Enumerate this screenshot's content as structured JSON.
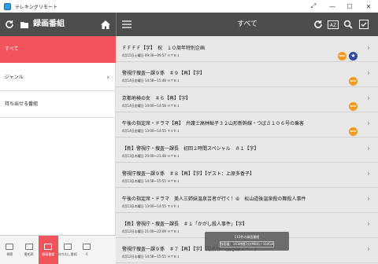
{
  "window": {
    "title": "テレキングリモート"
  },
  "left_header": {
    "title": "録画番組"
  },
  "right_header": {
    "title": "すべて"
  },
  "sidebar": {
    "items": [
      {
        "label": "すべて",
        "active": true
      },
      {
        "label": "ジャンル",
        "chevron": "›"
      },
      {
        "label": "持ち出せる番組"
      }
    ]
  },
  "bottom_nav": [
    {
      "label": "視聴"
    },
    {
      "label": "番組表"
    },
    {
      "label": "録画番組",
      "active": true
    },
    {
      "label": "持ち出し番組"
    },
    {
      "label": "そ"
    }
  ],
  "programs": [
    {
      "title": "ＦＦＦＦ【字】　祝　１０周年特別企画",
      "date": "4月15日土曜日 09:30～09:57 ＨＴＢ１",
      "new": true,
      "star": true
    },
    {
      "title": "警視庁捜査一課９係　＃９【再】【字】",
      "date": "4月14日金曜日 14:58～15:48 ＨＴＢ１",
      "new": true
    },
    {
      "title": "京都地検の女　＃６【再】【字】",
      "date": "4月14日金曜日 14:00～14:58 ＨＴＢ１",
      "new": true
    },
    {
      "title": "午後の指定席・ドラマ【再】　弁護士高林鮎子３２山形新幹線・つばさ１０６号の乗客",
      "date": "4月14日金曜日 13:00～14:55 ＴＶｈ１",
      "new": true
    },
    {
      "title": "【新】警視庁・捜査一課長　初回２時間スペシャル　＃１【字】",
      "date": "4月13日木曜日 20:00～21:48 ＨＴＢ１"
    },
    {
      "title": "警視庁捜査一課９係　＃８【再】【字】【ゲスト：上原多香子】",
      "date": "4月13日木曜日 14:58～15:55 ＨＴＢ１"
    },
    {
      "title": "午後の指定席・ドラマ　美人三姉妹温泉芸者が行く！⑥　松山道後温泉殺の舞殺人事件",
      "date": "4月13日木曜日 13:00～14:55 ＴＶｈ１"
    },
    {
      "title": "【新】警視庁・捜査一課長　＃１「かがし殺人事件」【字】",
      "date": "4月12日水曜日 21:00～22:09 ＨＴＢ１"
    },
    {
      "title": "警視庁捜査一課９係　＃７【再】【字】【最新作へ抜き縁スぺ...】",
      "date": "4月12日水曜日 14:58～15:55 ＨＴＢ１"
    }
  ],
  "toast": {
    "line1": "112件の録画番組",
    "line2": "残容量：161時間5分(MB4) / 164GB",
    "remaining_fraction": 0.98
  },
  "icons": {
    "chevron": "›",
    "star": "★",
    "new_badge": "NEW",
    "sort_badge": "AZ"
  }
}
